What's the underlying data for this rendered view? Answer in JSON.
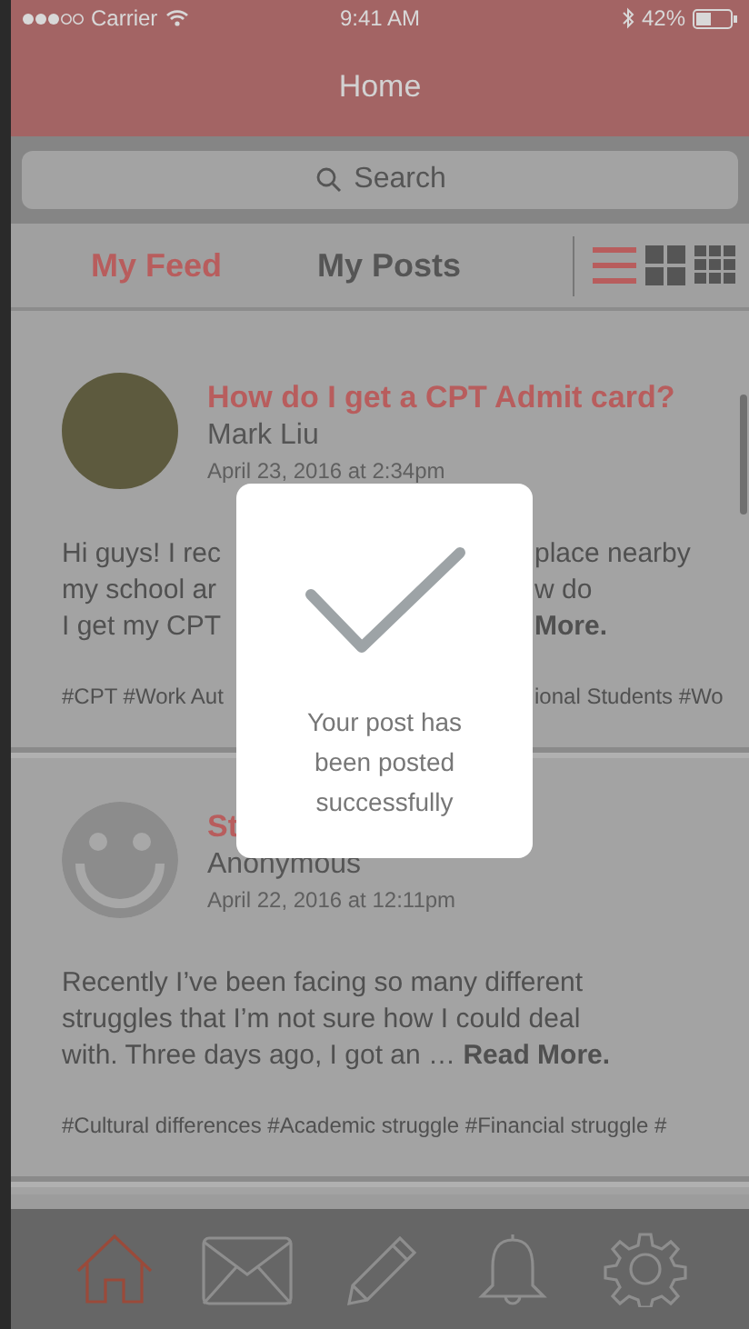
{
  "status_bar": {
    "carrier": "Carrier",
    "time": "9:41 AM",
    "battery": "42%"
  },
  "nav_bar": {
    "title": "Home"
  },
  "search": {
    "placeholder": "Search"
  },
  "tabs": [
    {
      "label": "My Feed",
      "selected": true
    },
    {
      "label": "My Posts",
      "selected": false
    }
  ],
  "view_modes": [
    {
      "kind": "list",
      "selected": true
    },
    {
      "kind": "grid",
      "selected": false
    },
    {
      "kind": "grid3",
      "selected": false
    }
  ],
  "posts": [
    {
      "kind": "photo",
      "title": "How do I get a CPT Admit card?",
      "author": "Mark Liu",
      "date": "April 23, 2016 at 2:34pm",
      "body_lines": [
        {
          "left": "Hi guys! I rec",
          "right": "place nearby"
        },
        {
          "left": "my school ar",
          "right": "w do"
        },
        {
          "left": "I get my CPT",
          "right": "**More.**"
        }
      ],
      "tags": {
        "left": "#CPT #Work Aut",
        "right": "ional Students #Wo"
      }
    },
    {
      "kind": "smiley",
      "title": "St",
      "author": "Anonymous",
      "date": "April 22, 2016 at 12:11pm",
      "body_lines": [
        {
          "left": "Recently I’ve been facing so many different"
        },
        {
          "left": "struggles that I’m not sure how I could deal"
        },
        {
          "left": "with. Three days ago, I got an … **Read More.**"
        }
      ],
      "tags": {
        "left": "#Cultural differences #Academic struggle #Financial struggle #"
      }
    }
  ],
  "dialog": {
    "message": "Your post has been posted successfully"
  },
  "bottom_nav": [
    {
      "kind": "home",
      "selected": true
    },
    {
      "kind": "mail",
      "selected": false
    },
    {
      "kind": "pencil",
      "selected": false
    },
    {
      "kind": "bell",
      "selected": false
    },
    {
      "kind": "gear",
      "selected": false
    }
  ]
}
